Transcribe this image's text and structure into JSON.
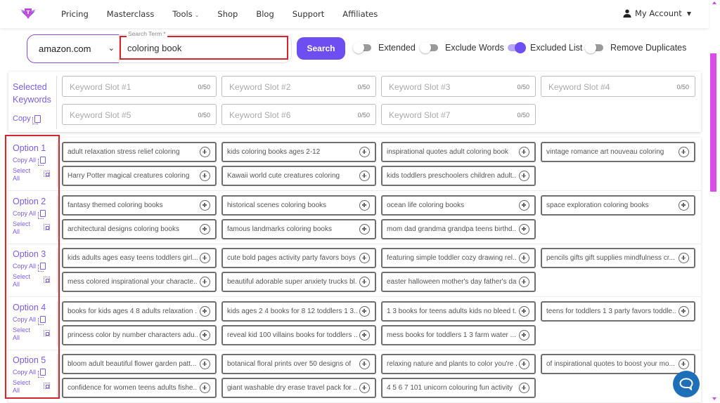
{
  "nav": {
    "logo": "winged-shield-logo",
    "links": [
      "Pricing",
      "Masterclass",
      "Tools",
      "Shop",
      "Blog",
      "Support",
      "Affiliates"
    ],
    "tools_has_dropdown": true,
    "account_label": "My Account"
  },
  "search": {
    "marketplace": "amazon.com",
    "term_label": "Search Term *",
    "term_value": "coloring book",
    "button_label": "Search"
  },
  "toggles": [
    {
      "label": "Extended",
      "on": false
    },
    {
      "label": "Exclude Words",
      "on": false
    },
    {
      "label": "Excluded List",
      "on": true
    },
    {
      "label": "Remove Duplicates",
      "on": false
    }
  ],
  "selected": {
    "title_line1": "Selected",
    "title_line2": "Keywords",
    "copy_label": "Copy",
    "slots": [
      {
        "placeholder": "Keyword Slot #1",
        "count": "0/50"
      },
      {
        "placeholder": "Keyword Slot #2",
        "count": "0/50"
      },
      {
        "placeholder": "Keyword Slot #3",
        "count": "0/50"
      },
      {
        "placeholder": "Keyword Slot #4",
        "count": "0/50"
      },
      {
        "placeholder": "Keyword Slot #5",
        "count": "0/50"
      },
      {
        "placeholder": "Keyword Slot #6",
        "count": "0/50"
      },
      {
        "placeholder": "Keyword Slot #7",
        "count": "0/50"
      }
    ]
  },
  "options": [
    {
      "label": "Option 1",
      "copy_all": "Copy All",
      "select_all": "Select All",
      "keywords": [
        "adult relaxation stress relief coloring",
        "kids coloring books ages 2-12",
        "inspirational quotes adult coloring book",
        "vintage romance art nouveau coloring",
        "Harry Potter magical creatures coloring",
        "Kawaii world cute creatures coloring",
        "kids toddlers preschoolers children adult..."
      ]
    },
    {
      "label": "Option 2",
      "copy_all": "Copy All",
      "select_all": "Select All",
      "keywords": [
        "fantasy themed coloring books",
        "historical scenes coloring books",
        "ocean life coloring books",
        "space exploration coloring books",
        "architectural designs coloring books",
        "famous landmarks coloring books",
        "mom dad grandma grandpa teens birthd..."
      ]
    },
    {
      "label": "Option 3",
      "copy_all": "Copy All",
      "select_all": "Select All",
      "keywords": [
        "kids adults ages easy teens toddlers girl...",
        "cute bold pages activity party favors boys",
        "featuring simple toddler cozy drawing rel...",
        "pencils gifts gift supplies mindfulness cr...",
        "mess colored inspirational your characte...",
        "beautiful adorable super anxiety trucks bl...",
        "easter halloween mother's day father's day"
      ]
    },
    {
      "label": "Option 4",
      "copy_all": "Copy All",
      "select_all": "Select All",
      "keywords": [
        "books for kids ages 4 8 adults relaxation ...",
        "kids ages 2 4 books for 8 12 toddlers 1 3...",
        "1 3 books for teens adults kids no bleed t...",
        "teens for toddlers 1 3 party favors toddle...",
        "princess color by number characters adu...",
        "reveal kid 100 villains books for toddlers ...",
        "mess books for toddlers 1 3 farm water ..."
      ]
    },
    {
      "label": "Option 5",
      "copy_all": "Copy All",
      "select_all": "Select All",
      "keywords": [
        "bloom adult beautiful flower garden patt...",
        "botanical floral prints over 50 designs of",
        "relaxing nature and plants to color you're ...",
        "of inspirational quotes to boost your mo...",
        "confidence for women teens adults fishe...",
        "giant washable dry erase travel pack for ...",
        "4 5 6 7 101 unicorn colouring fun activity"
      ]
    }
  ],
  "colors": {
    "accent": "#6d4ef0",
    "label_purple": "#7b5ce6",
    "highlight_red": "#d6232d",
    "scrollbar": "#d94ce8",
    "chat": "#1f6fb8"
  }
}
